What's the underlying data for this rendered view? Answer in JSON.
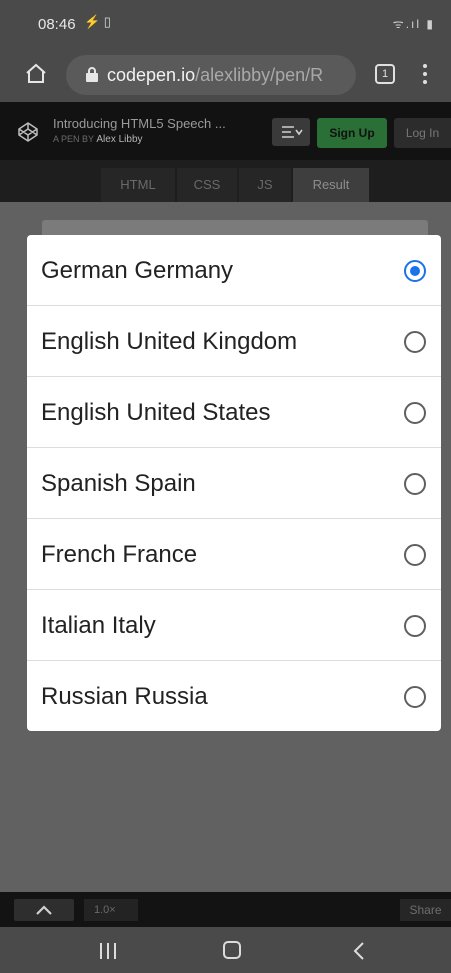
{
  "status_bar": {
    "time": "08:46",
    "left_icons": "⚡ ▯",
    "right_icons": "ᯤ.ıl ▮"
  },
  "browser": {
    "url_domain": "codepen.io",
    "url_path": "/alexlibby/pen/R",
    "tab_count": "1"
  },
  "codepen_header": {
    "pen_title": "Introducing HTML5 Speech ...",
    "author_prefix": "A PEN BY",
    "author_name": "Alex Libby",
    "signup_label": "Sign Up",
    "login_label": "Log In"
  },
  "editor_tabs": [
    {
      "label": "HTML"
    },
    {
      "label": "CSS"
    },
    {
      "label": "JS"
    },
    {
      "label": "Result"
    }
  ],
  "language_dialog": {
    "options": [
      {
        "label": "German Germany",
        "selected": true
      },
      {
        "label": "English United Kingdom",
        "selected": false
      },
      {
        "label": "English United States",
        "selected": false
      },
      {
        "label": "Spanish Spain",
        "selected": false
      },
      {
        "label": "French France",
        "selected": false
      },
      {
        "label": "Italian Italy",
        "selected": false
      },
      {
        "label": "Russian Russia",
        "selected": false
      }
    ]
  },
  "codepen_footer": {
    "zoom_label": "1.0×",
    "share_label": "Share"
  },
  "colors": {
    "accent": "#1a73e8",
    "signup_green": "#2a6f36"
  }
}
